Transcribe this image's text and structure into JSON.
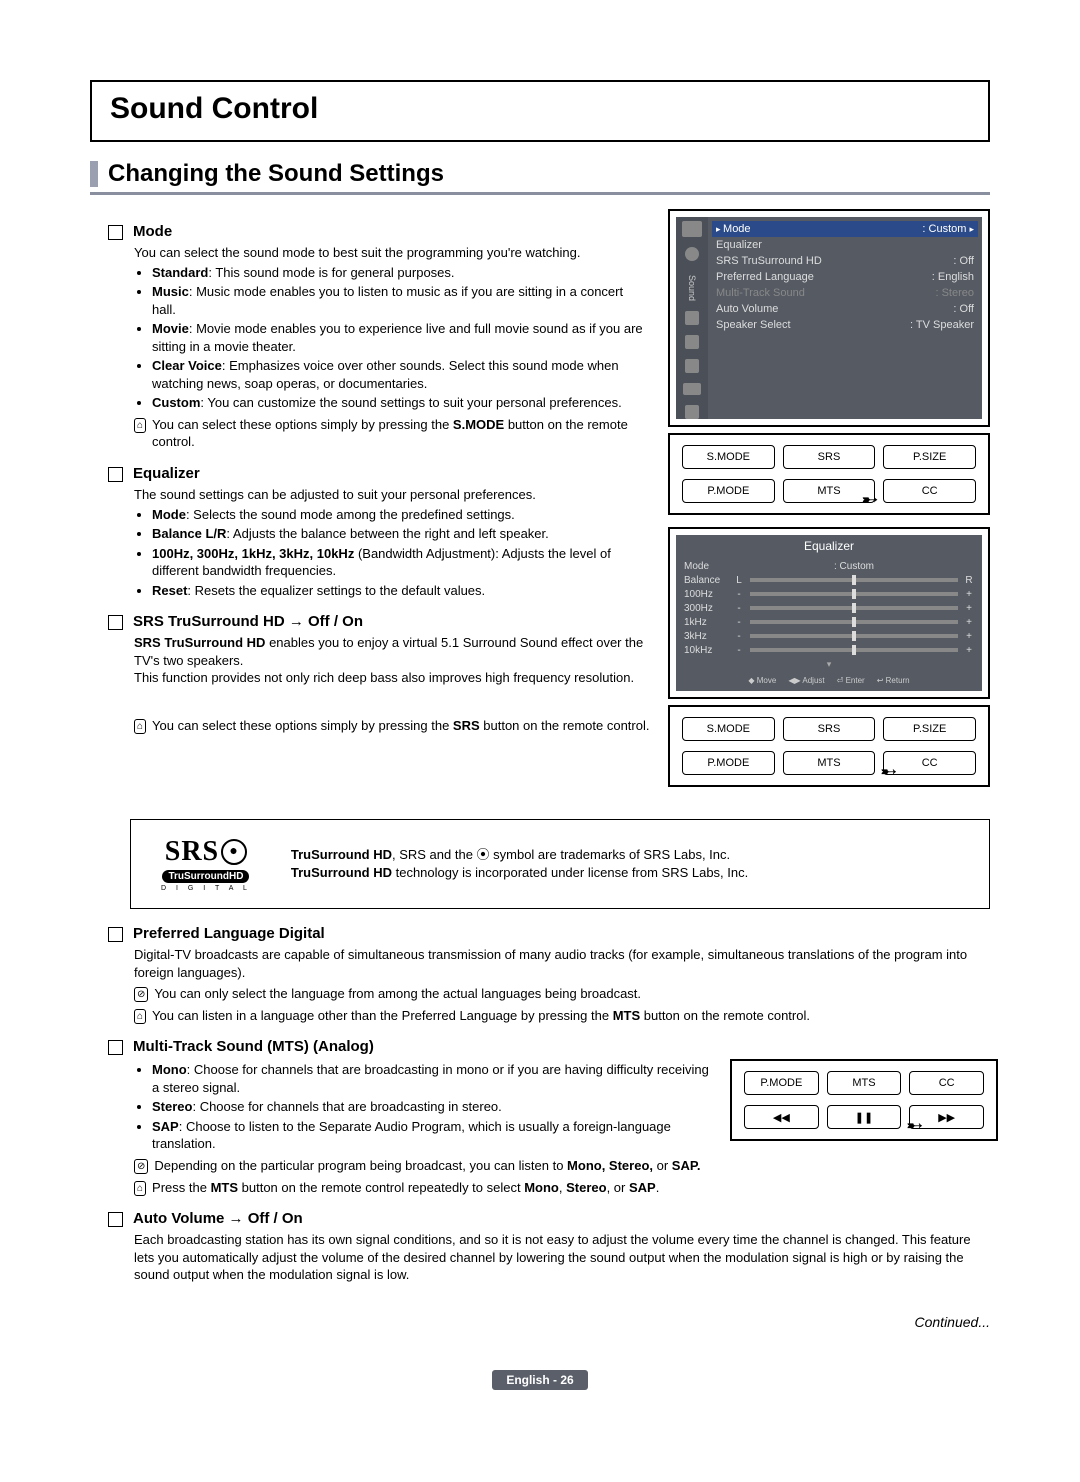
{
  "page_title": "Sound Control",
  "section_title": "Changing the Sound Settings",
  "mode": {
    "heading": "Mode",
    "intro": "You can select the sound mode to best suit the programming you're watching.",
    "items": [
      {
        "b": "Standard",
        "t": ": This sound mode is for general purposes."
      },
      {
        "b": "Music",
        "t": ": Music mode enables you to listen to music as if you are sitting in a concert hall."
      },
      {
        "b": "Movie",
        "t": ": Movie mode enables you to experience live and full movie sound as if you are sitting in a movie theater."
      },
      {
        "b": "Clear Voice",
        "t": ": Emphasizes voice over other sounds. Select this sound mode when watching news, soap operas, or documentaries."
      },
      {
        "b": "Custom",
        "t": ": You can customize the sound settings to suit your personal preferences."
      }
    ],
    "note_pre": "You can select these options simply by pressing the ",
    "note_bold": "S.MODE",
    "note_post": " button on the remote control."
  },
  "equalizer": {
    "heading": "Equalizer",
    "intro": "The sound settings can be adjusted to suit your personal preferences.",
    "items": [
      {
        "b": "Mode",
        "t": ": Selects the sound mode among the predefined settings."
      },
      {
        "b": "Balance L/R",
        "t": ": Adjusts the balance between the right and left speaker."
      },
      {
        "b": "100Hz, 300Hz, 1kHz, 3kHz, 10kHz",
        "t": " (Bandwidth Adjustment): Adjusts the level of different bandwidth frequencies."
      },
      {
        "b": "Reset",
        "t": ": Resets the equalizer settings to the default values."
      }
    ]
  },
  "srs": {
    "heading": "SRS TruSurround HD → Off / On",
    "intro_b": "SRS TruSurround HD",
    "intro_t": " enables you to enjoy a virtual 5.1 Surround Sound effect over the TV's two speakers.",
    "line2": "This function provides not only rich deep bass also improves high frequency resolution.",
    "note_pre": "You can select these options simply by pressing the ",
    "note_bold": "SRS",
    "note_post": " button on the remote control."
  },
  "trademark": {
    "logo_main": "SRS",
    "logo_pill": "TruSurroundHD",
    "logo_sub": "D I G I T A L",
    "line1_b1": "TruSurround HD",
    "line1_t": ", SRS and the ⦿ symbol are trademarks of SRS Labs, Inc.",
    "line2_b": "TruSurround HD",
    "line2_t": " technology is incorporated under license from SRS Labs, Inc."
  },
  "preflang": {
    "heading": "Preferred Language Digital",
    "intro": "Digital-TV broadcasts are capable of simultaneous transmission of many audio tracks (for example, simultaneous translations of the program into foreign languages).",
    "note1": "You can only select the language from among the actual languages being broadcast.",
    "note2_pre": "You can listen in a language other than the Preferred Language by pressing the ",
    "note2_bold": "MTS",
    "note2_post": " button on the remote control."
  },
  "mts": {
    "heading": "Multi-Track Sound (MTS) (Analog)",
    "items": [
      {
        "b": "Mono",
        "t": ": Choose for channels that are broadcasting in mono or if you are having difficulty receiving a stereo signal."
      },
      {
        "b": "Stereo",
        "t": ": Choose for channels that are broadcasting in stereo."
      },
      {
        "b": "SAP",
        "t": ": Choose to listen to the Separate Audio Program, which is usually a foreign-language translation."
      }
    ],
    "note1_pre": "Depending on the particular program being broadcast, you can listen to ",
    "note1_bold": "Mono, Stereo,",
    "note1_mid": " or ",
    "note1_bold2": "SAP.",
    "note2_pre": "Press the ",
    "note2_b1": "MTS",
    "note2_mid1": " button on the remote control repeatedly to select ",
    "note2_b2": "Mono",
    "note2_mid2": ", ",
    "note2_b3": "Stereo",
    "note2_mid3": ", or ",
    "note2_b4": "SAP",
    "note2_end": "."
  },
  "autovol": {
    "heading": "Auto Volume → Off / On",
    "text": "Each broadcasting station has its own signal conditions, and so it is not easy to adjust the volume every time the channel is changed. This feature lets you automatically adjust the volume of the desired channel by lowering the sound output when the modulation signal is high or by raising the sound output when the modulation signal is low."
  },
  "continued": "Continued...",
  "footer": "English - 26",
  "osd_sound": {
    "side_label": "Sound",
    "rows": [
      {
        "l": "Mode",
        "r": ": Custom",
        "hl": true,
        "arrow": true
      },
      {
        "l": "Equalizer",
        "r": ""
      },
      {
        "l": "SRS TruSurround HD",
        "r": ": Off"
      },
      {
        "l": "Preferred Language",
        "r": ": English"
      },
      {
        "l": "Multi-Track Sound",
        "r": ": Stereo",
        "dim": true
      },
      {
        "l": "Auto Volume",
        "r": ": Off"
      },
      {
        "l": "Speaker Select",
        "r": ": TV Speaker"
      }
    ]
  },
  "remote1": [
    "S.MODE",
    "SRS",
    "P.SIZE",
    "P.MODE",
    "MTS",
    "CC"
  ],
  "remote1_arrow_index": 4,
  "osd_eq": {
    "title": "Equalizer",
    "mode_row": {
      "l": "Mode",
      "r": ": Custom"
    },
    "balance": {
      "l": "Balance",
      "left": "L",
      "right": "R"
    },
    "bands": [
      "100Hz",
      "300Hz",
      "1kHz",
      "3kHz",
      "10kHz"
    ],
    "nav": [
      "◆ Move",
      "◀▶ Adjust",
      "⏎ Enter",
      "↩ Return"
    ]
  },
  "remote2": [
    "S.MODE",
    "SRS",
    "P.SIZE",
    "P.MODE",
    "MTS",
    "CC"
  ],
  "remote2_arrow_index": 5,
  "remote3": [
    "P.MODE",
    "MTS",
    "CC",
    "◀◀",
    "❚❚",
    "▶▶"
  ],
  "remote3_arrow_index": 5
}
